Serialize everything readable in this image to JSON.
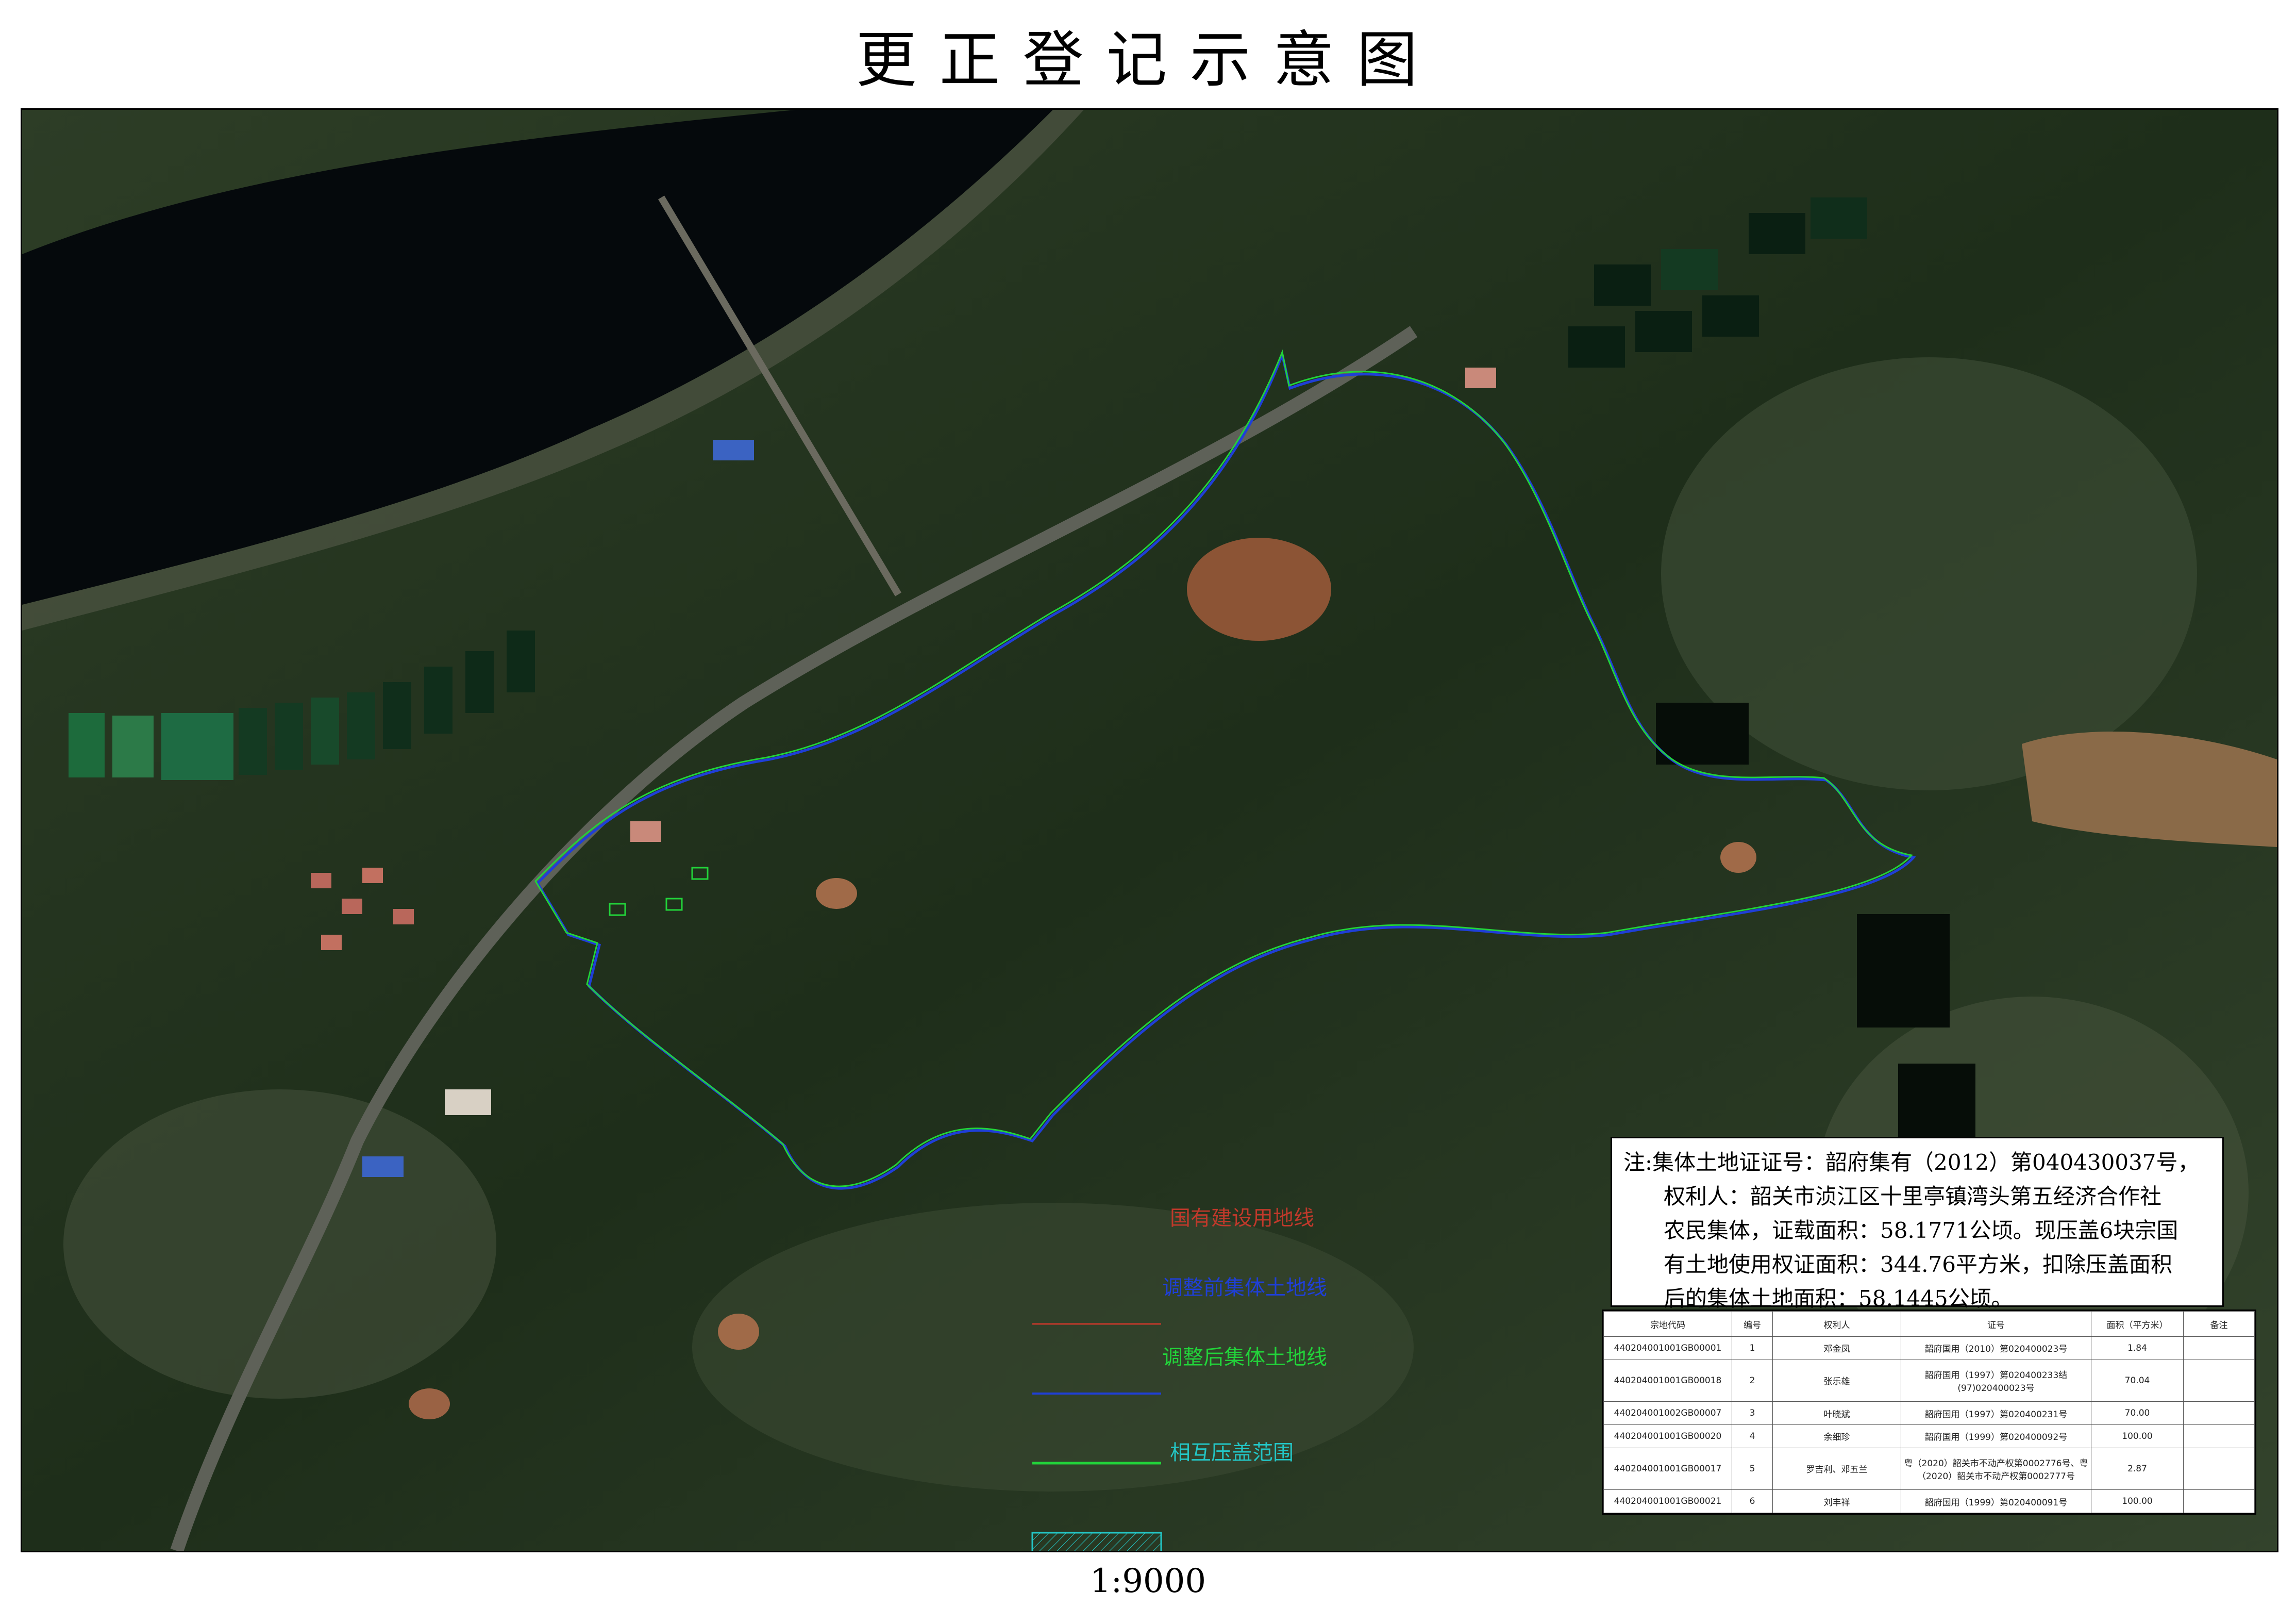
{
  "title": "更正登记示意图",
  "scale": "1:9000",
  "legend": {
    "items": [
      {
        "label": "国有建设用地线",
        "color": "#c0392b"
      },
      {
        "label": "调整前集体土地线",
        "color": "#1f3fd8"
      },
      {
        "label": "调整后集体土地线",
        "color": "#22d33a"
      },
      {
        "label": "相互压盖范围",
        "color": "#23c6c6"
      }
    ]
  },
  "note": {
    "line1": "注:集体土地证证号：韶府集有（2012）第040430037号，",
    "line2": "权利人：韶关市浈江区十里亭镇湾头第五经济合作社",
    "line3": "农民集体，证载面积：58.1771公顷。现压盖6块宗国",
    "line4": "有土地使用权证面积：344.76平方米，扣除压盖面积",
    "line5": "后的集体土地面积：58.1445公顷。"
  },
  "table": {
    "headers": [
      "宗地代码",
      "编号",
      "权利人",
      "证号",
      "面积（平方米）",
      "备注"
    ],
    "rows": [
      [
        "440204001001GB00001",
        "1",
        "邓金凤",
        "韶府国用（2010）第020400023号",
        "1.84",
        ""
      ],
      [
        "440204001001GB00018",
        "2",
        "张乐雄",
        "韶府国用（1997）第020400233结(97)020400023号",
        "70.04",
        ""
      ],
      [
        "440204001002GB00007",
        "3",
        "叶晓斌",
        "韶府国用（1997）第020400231号",
        "70.00",
        ""
      ],
      [
        "440204001001GB00020",
        "4",
        "余细珍",
        "韶府国用（1999）第020400092号",
        "100.00",
        ""
      ],
      [
        "440204001001GB00017",
        "5",
        "罗吉利、邓五兰",
        "粤（2020）韶关市不动产权第0002776号、粤（2020）韶关市不动产权第0002777号",
        "2.87",
        ""
      ],
      [
        "440204001001GB00021",
        "6",
        "刘丰祥",
        "韶府国用（1999）第020400091号",
        "100.00",
        ""
      ]
    ]
  }
}
